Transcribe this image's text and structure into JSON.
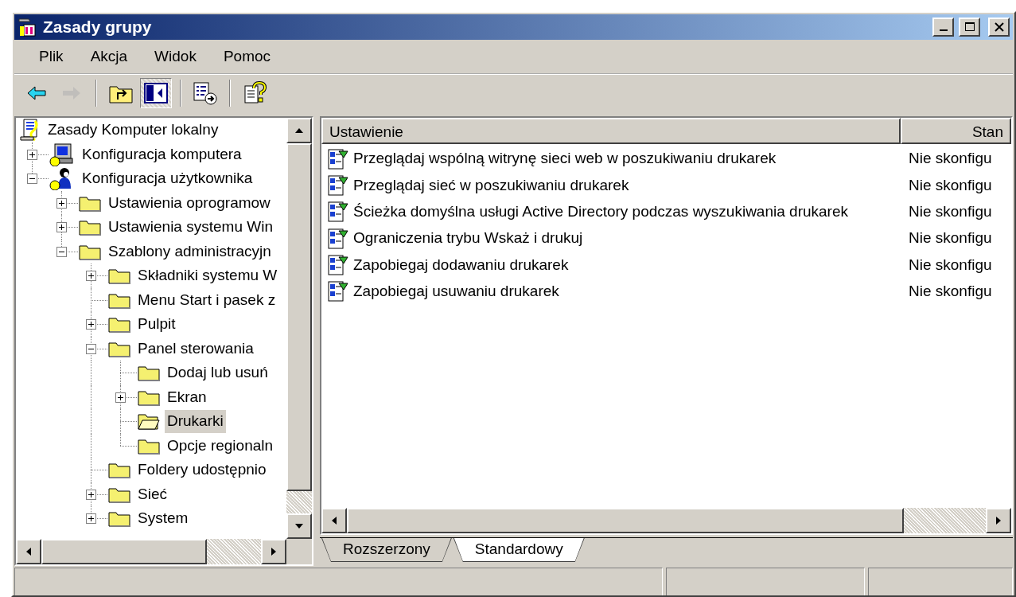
{
  "window": {
    "title": "Zasady grupy"
  },
  "menu": [
    "Plik",
    "Akcja",
    "Widok",
    "Pomoc"
  ],
  "toolbar": [
    {
      "kind": "back",
      "disabled": false,
      "pressed": false
    },
    {
      "kind": "forward",
      "disabled": true,
      "pressed": false
    },
    {
      "kind": "separator"
    },
    {
      "kind": "up",
      "disabled": false,
      "pressed": false
    },
    {
      "kind": "tree-toggle",
      "disabled": false,
      "pressed": true
    },
    {
      "kind": "separator"
    },
    {
      "kind": "export",
      "disabled": false,
      "pressed": false
    },
    {
      "kind": "separator"
    },
    {
      "kind": "help",
      "disabled": false,
      "pressed": false
    }
  ],
  "tree": {
    "items": [
      {
        "label": "Zasady Komputer lokalny",
        "kind": "root",
        "selected": false,
        "children": [
          {
            "label": "Konfiguracja komputera",
            "kind": "computer",
            "expandable": true,
            "expanded": false,
            "selected": false
          },
          {
            "label": "Konfiguracja użytkownika",
            "kind": "user",
            "expandable": true,
            "expanded": true,
            "selected": false,
            "children": [
              {
                "label": "Ustawienia oprogramow",
                "kind": "folder",
                "expandable": true,
                "expanded": false,
                "selected": false
              },
              {
                "label": "Ustawienia systemu Win",
                "kind": "folder",
                "expandable": true,
                "expanded": false,
                "selected": false
              },
              {
                "label": "Szablony administracyjn",
                "kind": "folder",
                "expandable": true,
                "expanded": true,
                "selected": false,
                "children": [
                  {
                    "label": "Składniki systemu W",
                    "kind": "folder",
                    "expandable": true,
                    "expanded": false,
                    "selected": false
                  },
                  {
                    "label": "Menu Start i pasek z",
                    "kind": "folder",
                    "expandable": false,
                    "selected": false
                  },
                  {
                    "label": "Pulpit",
                    "kind": "folder",
                    "expandable": true,
                    "expanded": false,
                    "selected": false
                  },
                  {
                    "label": "Panel sterowania",
                    "kind": "folder",
                    "expandable": true,
                    "expanded": true,
                    "selected": false,
                    "children": [
                      {
                        "label": "Dodaj lub usuń",
                        "kind": "folder",
                        "expandable": false,
                        "selected": false
                      },
                      {
                        "label": "Ekran",
                        "kind": "folder",
                        "expandable": true,
                        "expanded": false,
                        "selected": false
                      },
                      {
                        "label": "Drukarki",
                        "kind": "folder",
                        "expandable": false,
                        "selected": true
                      },
                      {
                        "label": "Opcje regionaln",
                        "kind": "folder",
                        "expandable": false,
                        "selected": false
                      }
                    ]
                  },
                  {
                    "label": "Foldery udostępnio",
                    "kind": "folder",
                    "expandable": false,
                    "selected": false
                  },
                  {
                    "label": "Sieć",
                    "kind": "folder",
                    "expandable": true,
                    "expanded": false,
                    "selected": false
                  },
                  {
                    "label": "System",
                    "kind": "folder",
                    "expandable": true,
                    "expanded": false,
                    "selected": false
                  }
                ]
              }
            ]
          }
        ]
      }
    ]
  },
  "list": {
    "columns": [
      "Ustawienie",
      "Stan"
    ],
    "rows": [
      {
        "setting": "Przeglądaj wspólną witrynę sieci web w poszukiwaniu drukarek",
        "state": "Nie skonfigu"
      },
      {
        "setting": "Przeglądaj sieć w poszukiwaniu drukarek",
        "state": "Nie skonfigu"
      },
      {
        "setting": "Ścieżka domyślna usługi Active Directory podczas wyszukiwania drukarek",
        "state": "Nie skonfigu"
      },
      {
        "setting": "Ograniczenia trybu Wskaż i drukuj",
        "state": "Nie skonfigu"
      },
      {
        "setting": "Zapobiegaj dodawaniu drukarek",
        "state": "Nie skonfigu"
      },
      {
        "setting": "Zapobiegaj usuwaniu drukarek",
        "state": "Nie skonfigu"
      }
    ]
  },
  "tabs": [
    {
      "label": "Rozszerzony",
      "selected": false
    },
    {
      "label": "Standardowy",
      "selected": true
    }
  ]
}
